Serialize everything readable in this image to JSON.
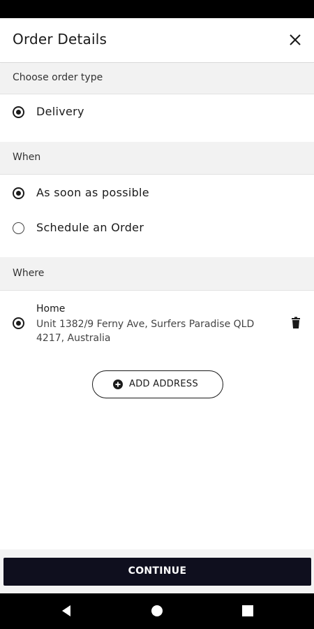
{
  "header": {
    "title": "Order Details",
    "close_icon": "close-icon"
  },
  "sections": {
    "order_type": {
      "title": "Choose order type",
      "options": [
        {
          "label": "Delivery",
          "selected": true
        }
      ]
    },
    "when": {
      "title": "When",
      "options": [
        {
          "label": "As soon as possible",
          "selected": true
        },
        {
          "label": "Schedule an Order",
          "selected": false
        }
      ]
    },
    "where": {
      "title": "Where",
      "address": {
        "name": "Home",
        "line": "Unit 1382/9 Ferny Ave, Surfers Paradise QLD 4217, Australia",
        "selected": true,
        "delete_icon": "trash-icon"
      },
      "add_button": {
        "label": "ADD ADDRESS",
        "icon": "plus-circle-icon"
      }
    }
  },
  "footer": {
    "continue_label": "CONTINUE"
  },
  "colors": {
    "primary": "#0f0f1e",
    "section_bg": "#f2f2f2",
    "text": "#1a1a1a"
  },
  "nav_bar": {
    "icons": [
      "back-icon",
      "home-icon",
      "recents-icon"
    ]
  }
}
